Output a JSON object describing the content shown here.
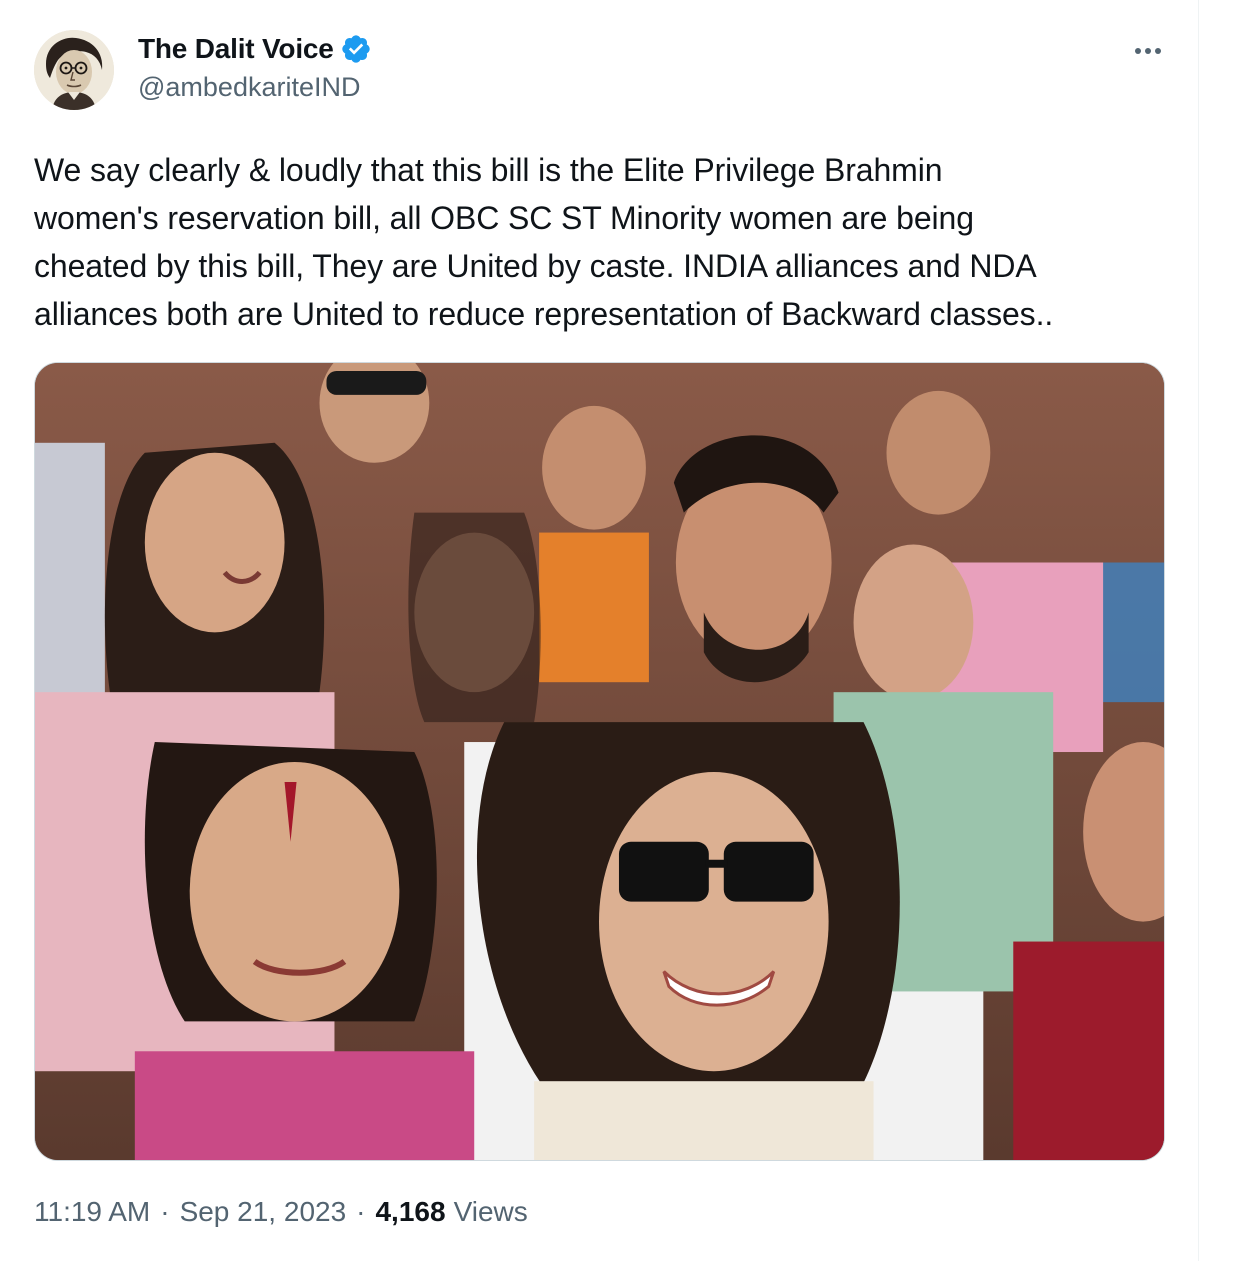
{
  "tweet": {
    "author": {
      "display_name": "The Dalit Voice",
      "handle": "@ambedkariteIND",
      "verified_icon": "verified-badge-icon",
      "avatar_icon": "portrait-sketch-avatar"
    },
    "more_icon": "more-options-icon",
    "text": "We say clearly & loudly that this bill is the Elite Privilege Brahmin\nwomen's reservation bill, all OBC SC ST Minority women are being\ncheated by this bill, They are United by caste. INDIA alliances and NDA\nalliances both are United to reduce representation of Backward classes..",
    "media": {
      "type": "photo"
    },
    "meta": {
      "time": "11:19 AM",
      "separator": "·",
      "date": "Sep 21, 2023",
      "views_count": "4,168",
      "views_label": "Views"
    }
  },
  "colors": {
    "text_primary": "#0f1419",
    "text_secondary": "#536471",
    "verified_blue": "#1d9bf0",
    "border": "#cfd9de"
  }
}
